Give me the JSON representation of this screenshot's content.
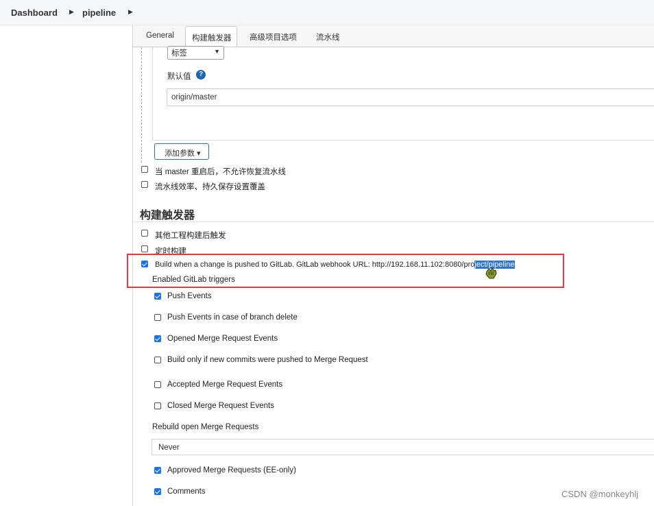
{
  "breadcrumb": {
    "dashboard": "Dashboard",
    "job": "pipeline"
  },
  "tabs": {
    "general": "General",
    "triggers": "构建触发器",
    "advanced": "高级项目选项",
    "pipeline": "流水线"
  },
  "parameter": {
    "select_value": "标签",
    "default_label": "默认值",
    "default_value": "origin/master",
    "add_button": "添加参数 ▾"
  },
  "options": {
    "no_resume": "当 master 重启后，不允许恢复流水线",
    "durability": "流水线效率、持久保存设置覆盖"
  },
  "triggers": {
    "title": "构建触发器",
    "after_other": "其他工程构建后触发",
    "periodic": "定时构建",
    "gitlab_prefix": "Build when a change is pushed to GitLab. GitLab webhook URL: http://192.168.11.102:8080/pro",
    "gitlab_selected": "ject/pipeline",
    "enabled_label": "Enabled GitLab triggers",
    "push_events": "Push Events",
    "push_branch_delete": "Push Events in case of branch delete",
    "opened_mr": "Opened Merge Request Events",
    "build_only_new": "Build only if new commits were pushed to Merge Request",
    "accepted_mr": "Accepted Merge Request Events",
    "closed_mr": "Closed Merge Request Events",
    "rebuild_label": "Rebuild open Merge Requests",
    "rebuild_value": "Never",
    "approved_mr": "Approved Merge Requests (EE-only)",
    "comments": "Comments"
  },
  "watermark": "CSDN @monkeyhlj",
  "colors": {
    "accent": "#1a73e8",
    "highlight": "#e8383d",
    "selection": "#2f75d6"
  }
}
